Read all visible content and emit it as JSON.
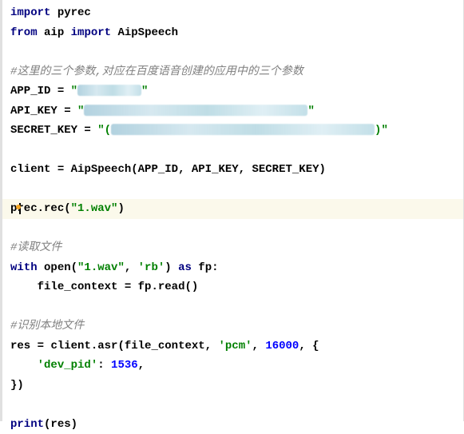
{
  "code": {
    "l1": {
      "kw1": "import",
      "mod": "pyrec"
    },
    "l2": {
      "kw1": "from",
      "mod": "aip",
      "kw2": "import",
      "cls": "AipSpeech"
    },
    "l3": {
      "comment": "#这里的三个参数,对应在百度语音创建的应用中的三个参数"
    },
    "l4": {
      "var": "APP_ID",
      "eq": " = ",
      "q1": "\"",
      "q2": "\""
    },
    "l5": {
      "var": "API_KEY",
      "eq": " = ",
      "q1": "\"",
      "q2": "\""
    },
    "l6": {
      "var": "SECRET_KEY",
      "eq": " = ",
      "q1": "\"(",
      "q2": ")\""
    },
    "l7": {
      "var": "client",
      "eq": " = ",
      "fn": "AipSpeech(APP_ID, API_KEY, SECRET_KEY)"
    },
    "l8": {
      "pre": "p",
      "post": "rec.rec(",
      "str": "\"1.wav\"",
      "close": ")"
    },
    "l9": {
      "comment": "#读取文件"
    },
    "l10": {
      "kw1": "with",
      "fn": " open(",
      "str1": "\"1.wav\"",
      "comma": ", ",
      "str2": "'rb'",
      "close": ") ",
      "kw2": "as",
      "var": " fp:"
    },
    "l11": {
      "indent": "    ",
      "var": "file_context",
      "eq": " = ",
      "call": "fp.read()"
    },
    "l12": {
      "comment": "#识别本地文件"
    },
    "l13": {
      "var": "res",
      "eq": " = ",
      "call": "client.asr(file_context, ",
      "str": "'pcm'",
      "comma": ", ",
      "num": "16000",
      "tail": ", {"
    },
    "l14": {
      "indent": "    ",
      "key": "'dev_pid'",
      "colon": ": ",
      "val": "1536",
      "comma": ","
    },
    "l15": {
      "text": "})"
    },
    "l16": {
      "fn": "print",
      "open": "(",
      "arg": "res",
      "close": ")"
    }
  }
}
